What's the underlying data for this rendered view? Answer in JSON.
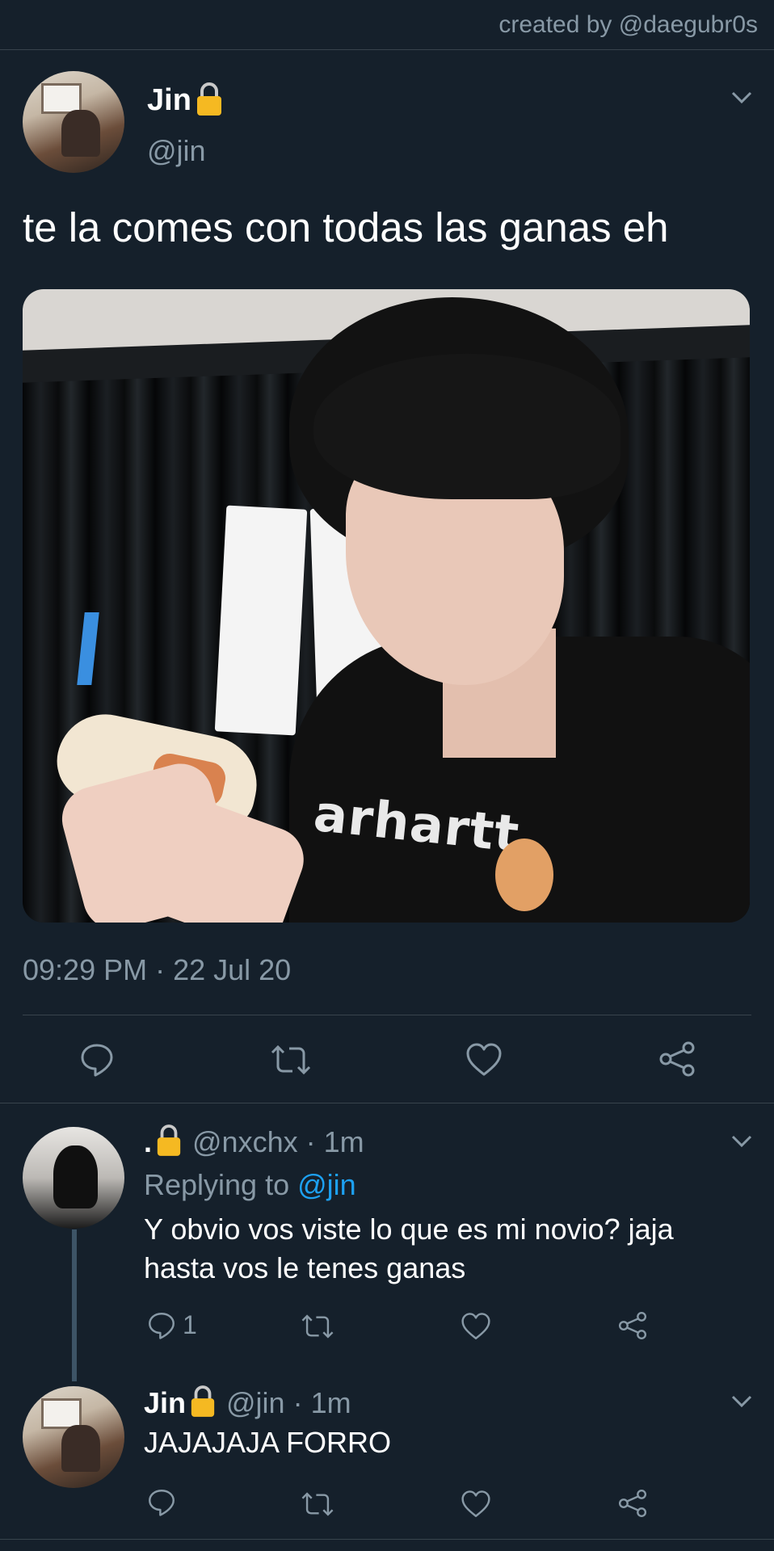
{
  "credit": "created by @daegubr0s",
  "main_tweet": {
    "display_name": "Jin",
    "handle": "@jin",
    "text": "te la comes con todas las ganas eh",
    "shirt_print": "arhartt",
    "timestamp": "09:29 PM · 22 Jul 20"
  },
  "reply1": {
    "display_name": ".",
    "handle": "@nxchx",
    "time": "· 1m",
    "replying_prefix": "Replying to ",
    "replying_handle": "@jin",
    "text_line1": "Y obvio vos viste lo que es mi novio? jaja",
    "text_line2": "hasta vos le tenes ganas",
    "reply_count": "1"
  },
  "reply2": {
    "display_name": "Jin",
    "handle": "@jin",
    "time": "· 1m",
    "text": "JAJAJAJA FORRO"
  },
  "icons": {
    "reply": "speech-bubble",
    "retweet": "retweet-arrows",
    "like": "heart-outline",
    "share": "share-nodes",
    "lock": "lock-emoji",
    "more": "chevron-down"
  },
  "colors": {
    "background": "#15202b",
    "text_secondary": "#8899a6",
    "link": "#1da1f2",
    "divider": "#38444d"
  }
}
